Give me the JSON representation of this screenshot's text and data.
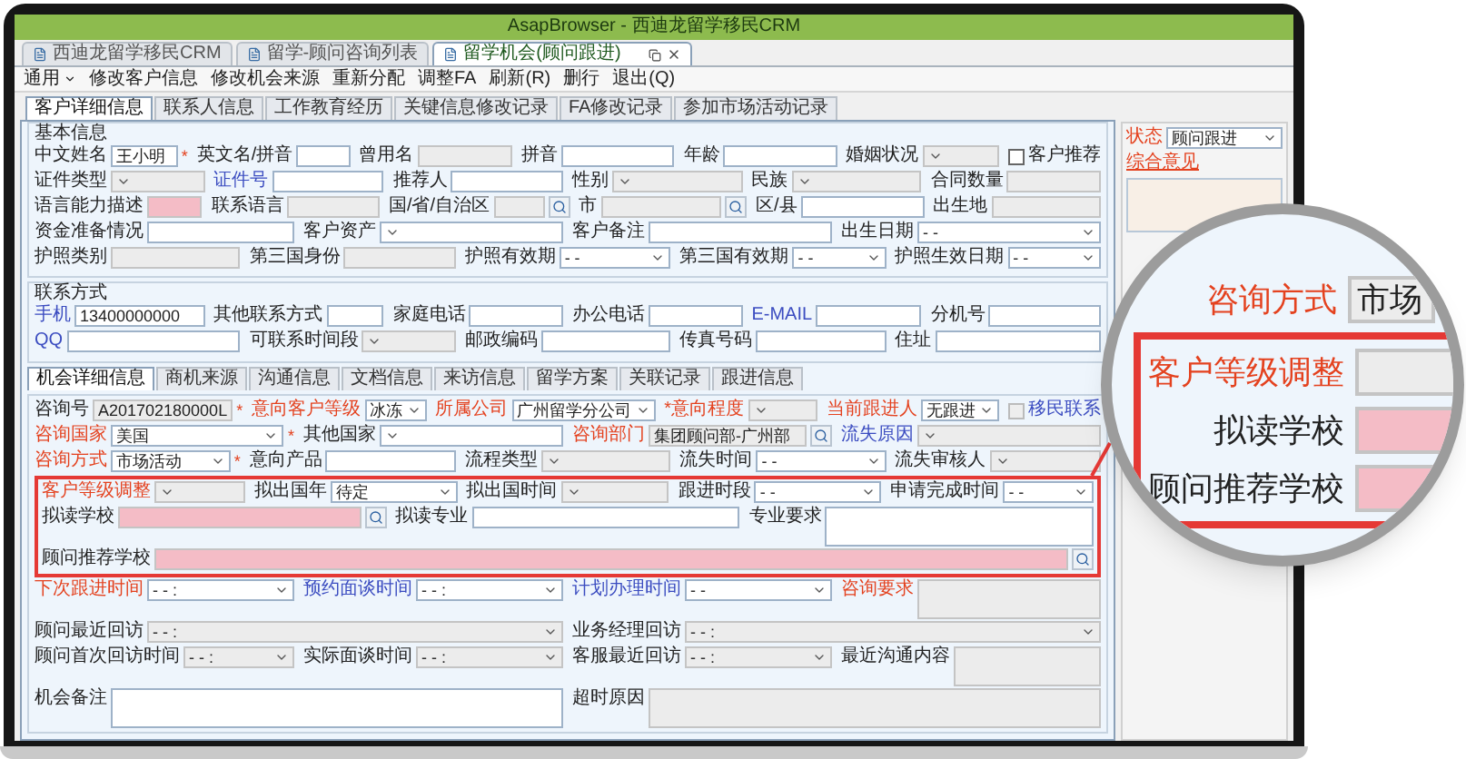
{
  "window": {
    "title": "AsapBrowser - 西迪龙留学移民CRM"
  },
  "browser_tabs": [
    {
      "label": "西迪龙留学移民CRM",
      "selected": false
    },
    {
      "label": "留学-顾问咨询列表",
      "selected": false
    },
    {
      "label": "留学机会(顾问跟进)",
      "selected": true
    }
  ],
  "toolbar": [
    {
      "label": "通用",
      "menu": true
    },
    {
      "label": "修改客户信息",
      "menu": false
    },
    {
      "label": "修改机会来源",
      "menu": false
    },
    {
      "label": "重新分配",
      "menu": false
    },
    {
      "label": "调整FA",
      "menu": false
    },
    {
      "label": "刷新(R)",
      "menu": false
    },
    {
      "label": "删行",
      "menu": false
    },
    {
      "label": "退出(Q)",
      "menu": false
    }
  ],
  "form_tabs": [
    {
      "label": "客户详细信息",
      "selected": true
    },
    {
      "label": "联系人信息",
      "selected": false
    },
    {
      "label": "工作教育经历",
      "selected": false
    },
    {
      "label": "关键信息修改记录",
      "selected": false
    },
    {
      "label": "FA修改记录",
      "selected": false
    },
    {
      "label": "参加市场活动记录",
      "selected": false
    }
  ],
  "basic_info": {
    "title": "基本信息",
    "rows": [
      {
        "fields": [
          {
            "kind": "text",
            "label": "中文姓名",
            "value": "王小明",
            "suffix": "*",
            "disabled": false,
            "highlighted": false
          },
          {
            "kind": "text",
            "label": "英文名/拼音",
            "disabled": false,
            "highlighted": false
          },
          {
            "kind": "text",
            "label": "曾用名",
            "disabled": true,
            "highlighted": false
          },
          {
            "kind": "text",
            "label": "拼音",
            "disabled": false,
            "highlighted": false
          },
          {
            "kind": "text",
            "label": "年龄",
            "disabled": false,
            "highlighted": false
          },
          {
            "kind": "select",
            "label": "婚姻状况",
            "disabled": true,
            "highlighted": false
          },
          {
            "kind": "checkbox",
            "label": "客户推荐",
            "checked": false,
            "disabled": false,
            "highlighted": false
          }
        ]
      },
      {
        "fields": [
          {
            "kind": "select",
            "label": "证件类型",
            "disabled": true,
            "highlighted": false
          },
          {
            "kind": "text",
            "label": "证件号",
            "color": "#3b4cc0",
            "disabled": false,
            "highlighted": false
          },
          {
            "kind": "text",
            "label": "推荐人",
            "disabled": false,
            "highlighted": false
          },
          {
            "kind": "select",
            "label": "性别",
            "disabled": true,
            "highlighted": false
          },
          {
            "kind": "select",
            "label": "民族",
            "disabled": true,
            "highlighted": false
          },
          {
            "kind": "text",
            "label": "合同数量",
            "disabled": true,
            "highlighted": false
          }
        ]
      },
      {
        "fields": [
          {
            "kind": "text",
            "label": "语言能力描述",
            "disabled": false,
            "highlighted": true
          },
          {
            "kind": "text",
            "label": "联系语言",
            "disabled": true,
            "highlighted": false
          },
          {
            "kind": "lookup",
            "label": "国/省/自治区",
            "disabled": true,
            "highlighted": false
          },
          {
            "kind": "lookup",
            "label": "市",
            "disabled": true,
            "highlighted": false
          },
          {
            "kind": "text",
            "label": "区/县",
            "disabled": false,
            "highlighted": false
          },
          {
            "kind": "text",
            "label": "出生地",
            "disabled": true,
            "highlighted": false
          }
        ]
      },
      {
        "fields": [
          {
            "kind": "text",
            "label": "资金准备情况",
            "disabled": false,
            "highlighted": false
          },
          {
            "kind": "select",
            "label": "客户资产",
            "disabled": false,
            "highlighted": false
          },
          {
            "kind": "text",
            "label": "客户备注",
            "disabled": false,
            "highlighted": false
          },
          {
            "kind": "select",
            "label": "出生日期",
            "value": "- -",
            "disabled": false,
            "highlighted": false
          }
        ]
      },
      {
        "fields": [
          {
            "kind": "text",
            "label": "护照类别",
            "disabled": true,
            "highlighted": false
          },
          {
            "kind": "text",
            "label": "第三国身份",
            "disabled": true,
            "highlighted": false
          },
          {
            "kind": "select",
            "label": "护照有效期",
            "value": "- -",
            "disabled": false,
            "highlighted": false
          },
          {
            "kind": "select",
            "label": "第三国有效期",
            "value": "- -",
            "disabled": false,
            "highlighted": false
          },
          {
            "kind": "select",
            "label": "护照生效日期",
            "value": "- -",
            "disabled": false,
            "highlighted": false
          }
        ]
      }
    ]
  },
  "contact": {
    "title": "联系方式",
    "rows": [
      {
        "fields": [
          {
            "kind": "text",
            "label": "手机",
            "color": "#3b4cc0",
            "value": "13400000000",
            "disabled": false,
            "highlighted": false
          },
          {
            "kind": "text",
            "label": "其他联系方式",
            "disabled": false,
            "highlighted": false
          },
          {
            "kind": "text",
            "label": "家庭电话",
            "disabled": false,
            "highlighted": false
          },
          {
            "kind": "text",
            "label": "办公电话",
            "disabled": false,
            "highlighted": false
          },
          {
            "kind": "text",
            "label": "E-MAIL",
            "color": "#3b4cc0",
            "disabled": false,
            "highlighted": false
          },
          {
            "kind": "text",
            "label": "分机号",
            "disabled": false,
            "highlighted": false
          }
        ]
      },
      {
        "fields": [
          {
            "kind": "text",
            "label": "QQ",
            "color": "#3b4cc0",
            "disabled": false,
            "highlighted": false
          },
          {
            "kind": "select",
            "label": "可联系时间段",
            "disabled": true,
            "highlighted": false
          },
          {
            "kind": "text",
            "label": "邮政编码",
            "disabled": false,
            "highlighted": false
          },
          {
            "kind": "text",
            "label": "传真号码",
            "disabled": false,
            "highlighted": false
          },
          {
            "kind": "text",
            "label": "住址",
            "disabled": false,
            "highlighted": false
          }
        ]
      }
    ]
  },
  "detail_tabs": [
    {
      "label": "机会详细信息",
      "selected": true
    },
    {
      "label": "商机来源",
      "selected": false
    },
    {
      "label": "沟通信息",
      "selected": false
    },
    {
      "label": "文档信息",
      "selected": false
    },
    {
      "label": "来访信息",
      "selected": false
    },
    {
      "label": "留学方案",
      "selected": false
    },
    {
      "label": "关联记录",
      "selected": false
    },
    {
      "label": "跟进信息",
      "selected": false
    }
  ],
  "detail": {
    "rows": [
      {
        "fields": [
          {
            "kind": "text",
            "label": "咨询号",
            "value": "A201702180000L",
            "suffix": "*",
            "disabled": true,
            "highlighted": false
          },
          {
            "kind": "select",
            "label": "意向客户等级",
            "color": "#e4421f",
            "value": "冰冻",
            "disabled": false,
            "highlighted": false
          },
          {
            "kind": "select",
            "label": "所属公司",
            "color": "#e4421f",
            "value": "广州留学分公司",
            "disabled": false,
            "highlighted": false
          },
          {
            "kind": "select",
            "label": "*意向程度",
            "color": "#e4421f",
            "disabled": true,
            "highlighted": false
          },
          {
            "kind": "select",
            "label": "当前跟进人",
            "color": "#e4421f",
            "value": "无跟进",
            "disabled": false,
            "highlighted": false
          },
          {
            "kind": "checkbox",
            "label": "移民联系",
            "color": "#3b4cc0",
            "checked": false,
            "disabled": true,
            "highlighted": false
          }
        ]
      },
      {
        "fields": [
          {
            "kind": "select",
            "label": "咨询国家",
            "color": "#e4421f",
            "value": "美国",
            "suffix": "*",
            "disabled": false,
            "highlighted": false
          },
          {
            "kind": "select",
            "label": "其他国家",
            "disabled": false,
            "highlighted": false
          },
          {
            "kind": "lookup",
            "label": "咨询部门",
            "color": "#e4421f",
            "value": "集团顾问部-广州部",
            "disabled": true,
            "highlighted": false
          },
          {
            "kind": "select",
            "label": "流失原因",
            "color": "#3b4cc0",
            "disabled": true,
            "highlighted": false
          }
        ]
      },
      {
        "fields": [
          {
            "kind": "select",
            "label": "咨询方式",
            "color": "#e4421f",
            "value": "市场活动",
            "suffix": "*",
            "disabled": false,
            "highlighted": false
          },
          {
            "kind": "text",
            "label": "意向产品",
            "disabled": false,
            "highlighted": false
          },
          {
            "kind": "select",
            "label": "流程类型",
            "disabled": true,
            "highlighted": false
          },
          {
            "kind": "select",
            "label": "流失时间",
            "value": "- -",
            "disabled": false,
            "highlighted": false
          },
          {
            "kind": "select",
            "label": "流失审核人",
            "disabled": true,
            "highlighted": false
          }
        ]
      }
    ],
    "framed_rows": [
      {
        "fields": [
          {
            "kind": "select",
            "label": "客户等级调整",
            "color": "#e4421f",
            "disabled": true,
            "highlighted": false
          },
          {
            "kind": "select",
            "label": "拟出国年",
            "value": "待定",
            "disabled": false,
            "highlighted": false
          },
          {
            "kind": "select",
            "label": "拟出国时间",
            "disabled": true,
            "highlighted": false
          },
          {
            "kind": "select",
            "label": "跟进时段",
            "value": "- -",
            "disabled": false,
            "highlighted": false
          },
          {
            "kind": "select",
            "label": "申请完成时间",
            "value": "- -",
            "disabled": false,
            "highlighted": false
          }
        ]
      },
      {
        "fields": [
          {
            "kind": "lookup",
            "label": "拟读学校",
            "disabled": false,
            "highlighted": true
          },
          {
            "kind": "text",
            "label": "拟读专业",
            "disabled": false,
            "highlighted": false
          },
          {
            "kind": "textarea",
            "label": "专业要求",
            "disabled": false,
            "highlighted": false
          }
        ]
      },
      {
        "fields": [
          {
            "kind": "lookup",
            "label": "顾问推荐学校",
            "disabled": false,
            "highlighted": true
          }
        ]
      }
    ],
    "more_rows": [
      {
        "fields": [
          {
            "kind": "select",
            "label": "下次跟进时间",
            "color": "#e4421f",
            "value": "- -  :",
            "disabled": false,
            "highlighted": false
          },
          {
            "kind": "select",
            "label": "预约面谈时间",
            "color": "#3b4cc0",
            "value": "- -  :",
            "disabled": false,
            "highlighted": false
          },
          {
            "kind": "select",
            "label": "计划办理时间",
            "color": "#3b4cc0",
            "value": "- -",
            "disabled": false,
            "highlighted": false
          },
          {
            "kind": "textarea",
            "label": "咨询要求",
            "color": "#e4421f",
            "disabled": true,
            "highlighted": false
          }
        ]
      },
      {
        "fields": [
          {
            "kind": "select",
            "label": "顾问最近回访",
            "value": "- -  :",
            "disabled": true,
            "highlighted": false
          },
          {
            "kind": "select",
            "label": "业务经理回访",
            "value": "- -  :",
            "disabled": true,
            "highlighted": false
          }
        ]
      },
      {
        "fields": [
          {
            "kind": "select",
            "label": "顾问首次回访时间",
            "value": "- -  :",
            "disabled": true,
            "highlighted": false
          },
          {
            "kind": "select",
            "label": "实际面谈时间",
            "value": "- -  :",
            "disabled": true,
            "highlighted": false
          },
          {
            "kind": "select",
            "label": "客服最近回访",
            "value": "- -  :",
            "disabled": true,
            "highlighted": false
          },
          {
            "kind": "textarea",
            "label": "最近沟通内容",
            "disabled": true,
            "highlighted": false
          }
        ]
      },
      {
        "fields": [
          {
            "kind": "textarea",
            "label": "机会备注",
            "disabled": false,
            "highlighted": false
          },
          {
            "kind": "textarea",
            "label": "超时原因",
            "disabled": true,
            "highlighted": false
          }
        ]
      }
    ]
  },
  "side_panel": {
    "status": {
      "kind": "select",
      "label": "状态",
      "color": "#e4421f",
      "value": "顾问跟进",
      "disabled": false,
      "highlighted": false
    },
    "remarks": {
      "label": "综合意见",
      "color": "#e4421f"
    }
  },
  "magnifier": {
    "top_row": {
      "label": "咨询方式",
      "color": "#e4421f",
      "value": "市场",
      "disabled": true,
      "highlighted": false
    },
    "framed_rows": [
      {
        "label": "客户等级调整",
        "color": "#e4421f",
        "disabled": true,
        "highlighted": false
      },
      {
        "label": "拟读学校",
        "disabled": false,
        "highlighted": true
      },
      {
        "label": "顾问推荐学校",
        "disabled": false,
        "highlighted": true
      }
    ]
  }
}
